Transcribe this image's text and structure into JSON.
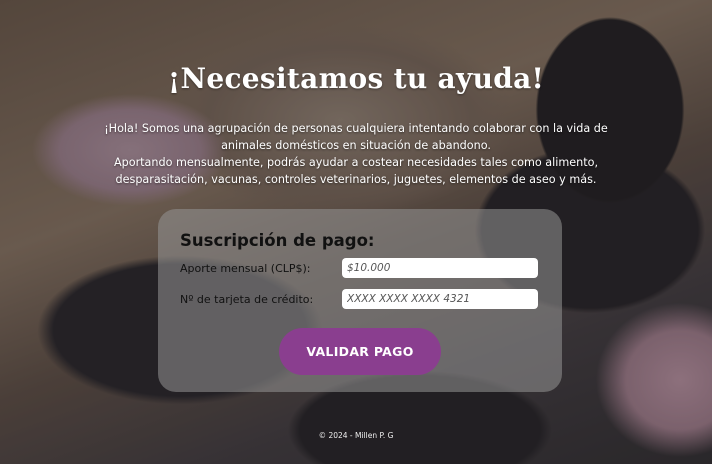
{
  "header": {
    "title": "¡Necesitamos tu ayuda!"
  },
  "intro": {
    "p1": "¡Hola! Somos una agrupación de personas cualquiera intentando colaborar con la vida de animales domésticos en situación de abandono.",
    "p2": "Aportando mensualmente, podrás ayudar a costear necesidades tales como alimento, desparasitación, vacunas, controles veterinarios, juguetes, elementos de aseo y más."
  },
  "form": {
    "title": "Suscripción de pago:",
    "amount_label": "Aporte mensual (CLP$):",
    "amount_placeholder": "$10.000",
    "card_label": "Nº de tarjeta de crédito:",
    "card_placeholder": "XXXX XXXX XXXX 4321",
    "submit_label": "VALIDAR PAGO"
  },
  "footer": {
    "text": "© 2024 - Millen P. G"
  },
  "colors": {
    "button": "#8a3e8f",
    "card_bg": "rgba(150,150,150,0.55)"
  }
}
